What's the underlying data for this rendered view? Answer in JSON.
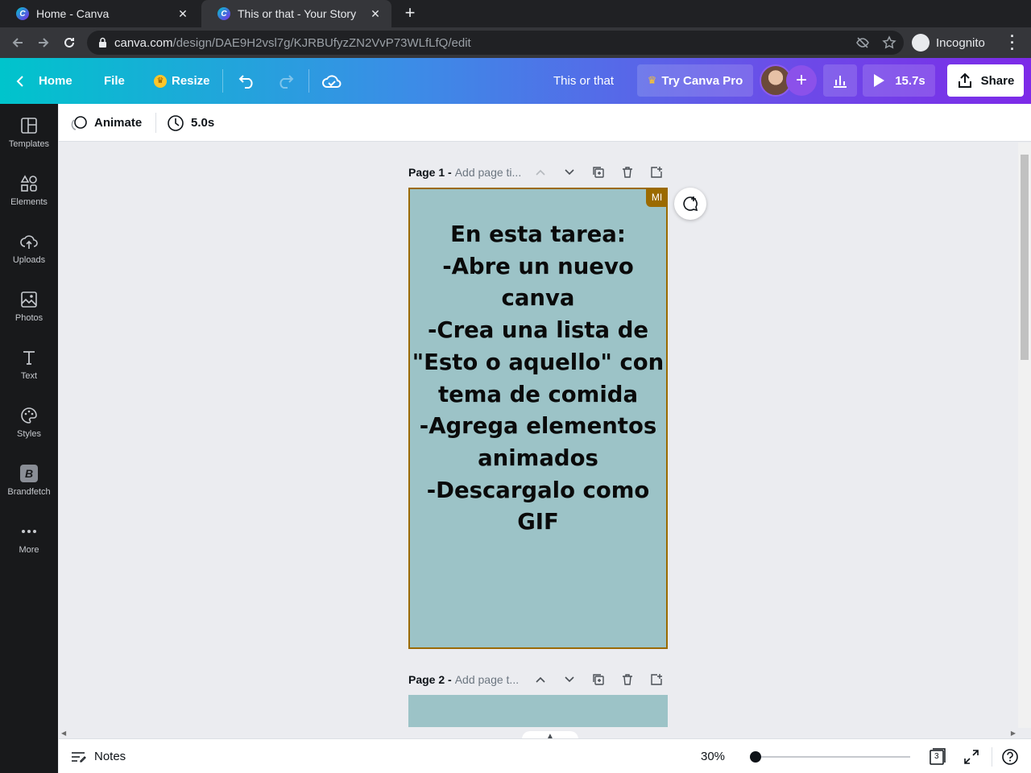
{
  "browser": {
    "tabs": [
      {
        "title": "Home - Canva",
        "close": "✕"
      },
      {
        "title": "This or that - Your Story",
        "close": "✕"
      }
    ],
    "new_tab": "+",
    "url_host": "canva.com",
    "url_path": "/design/DAE9H2vsl7g/KJRBUfyzZN2VvP73WLfLfQ/edit",
    "incognito_label": "Incognito"
  },
  "header": {
    "home_label": "Home",
    "file_label": "File",
    "resize_label": "Resize",
    "design_title": "This or that",
    "pro_label": "Try Canva Pro",
    "add_label": "+",
    "play_duration": "15.7s",
    "share_label": "Share"
  },
  "sidebar": {
    "items": [
      {
        "label": "Templates",
        "icon": "templates-icon"
      },
      {
        "label": "Elements",
        "icon": "elements-icon"
      },
      {
        "label": "Uploads",
        "icon": "uploads-icon"
      },
      {
        "label": "Photos",
        "icon": "photos-icon"
      },
      {
        "label": "Text",
        "icon": "text-icon"
      },
      {
        "label": "Styles",
        "icon": "styles-icon"
      },
      {
        "label": "Brandfetch",
        "icon": "brandfetch-icon",
        "glyph": "B"
      },
      {
        "label": "More",
        "icon": "more-icon"
      }
    ]
  },
  "context_bar": {
    "animate_label": "Animate",
    "duration": "5.0s"
  },
  "pages": [
    {
      "label": "Page 1 -",
      "title_placeholder": "Add page ti...",
      "collaborator_badge": "MI",
      "lines": [
        "En esta tarea:",
        "-Abre un nuevo",
        "canva",
        "-Crea una lista de",
        "\"Esto o aquello\" con",
        "tema de comida",
        "-Agrega elementos",
        "animados",
        "-Descargalo como",
        "GIF"
      ],
      "background": "#9cc3c7"
    },
    {
      "label": "Page 2 -",
      "title_placeholder": "Add page t..."
    }
  ],
  "footer": {
    "notes_label": "Notes",
    "zoom": "30%",
    "zoom_fraction": 0.0,
    "page_count": "3"
  },
  "colors": {
    "accent_purple": "#7d2ae8",
    "accent_teal": "#00c4cc",
    "collaborator": "#9b6a00"
  }
}
